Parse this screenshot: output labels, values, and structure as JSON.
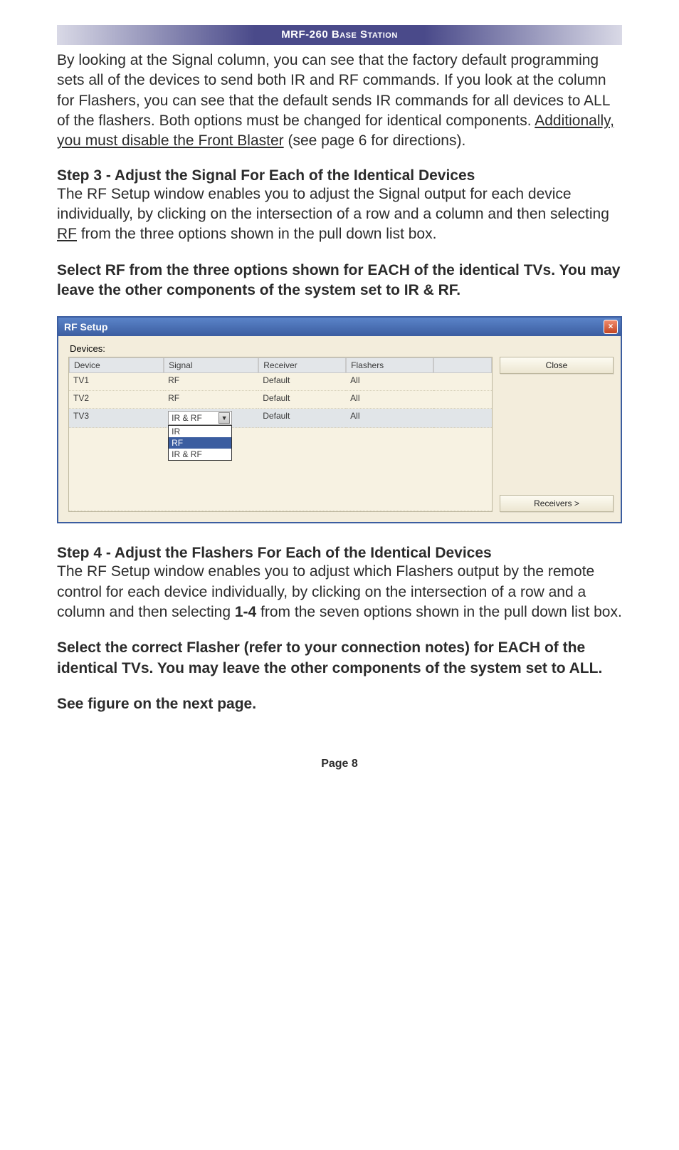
{
  "header": {
    "title": "MRF-260 Base Station"
  },
  "intro": {
    "before_underline": "By looking at the Signal column, you can see that the factory default programming sets all of the devices to send both IR and RF commands.  If you look at the column for Flashers, you can see that the default sends IR commands for all devices to ALL of the flashers. Both options must be changed for identical components. ",
    "underline": "Additionally, you must disable the Front Blaster",
    "after_underline": " (see page 6 for directions)."
  },
  "step3": {
    "title": "Step 3 - Adjust the Signal For Each of the Identical Devices",
    "body_before": "The RF Setup window enables you to adjust the Signal output for each device individually, by clicking on the intersection of a row and a column and then selecting ",
    "body_ul": "RF",
    "body_after": " from the three options shown in the pull down list box.",
    "callout": "Select RF from the three options shown for EACH of the identical TVs. You may leave the other components of the system set to IR & RF."
  },
  "rf_window": {
    "title": "RF Setup",
    "devices_label": "Devices:",
    "headers": {
      "device": "Device",
      "signal": "Signal",
      "receiver": "Receiver",
      "flashers": "Flashers",
      "blank": ""
    },
    "rows": [
      {
        "device": "TV1",
        "signal": "RF",
        "receiver": "Default",
        "flashers": "All"
      },
      {
        "device": "TV2",
        "signal": "RF",
        "receiver": "Default",
        "flashers": "All"
      },
      {
        "device": "TV3",
        "signal": "IR & RF",
        "receiver": "Default",
        "flashers": "All",
        "highlight": true,
        "dropdown_open": true
      }
    ],
    "dropdown_options": [
      {
        "label": "IR",
        "selected": false
      },
      {
        "label": "RF",
        "selected": true
      },
      {
        "label": "IR & RF",
        "selected": false
      }
    ],
    "buttons": {
      "close": "Close",
      "receivers": "Receivers >"
    }
  },
  "step4": {
    "title": "Step 4 - Adjust the Flashers For Each of the Identical Devices",
    "body_before": "The RF Setup window enables you to adjust which Flashers output by the remote control for each device individually, by clicking on the intersection of a row and a column and then selecting ",
    "body_bold": "1-4",
    "body_after": "  from the seven options shown in the pull down list box.",
    "callout": "Select the correct Flasher (refer to your connection notes) for EACH of the identical TVs. You may leave the other components of the system set to ALL.",
    "see_next": "See figure on the next page."
  },
  "page_number": "Page 8"
}
